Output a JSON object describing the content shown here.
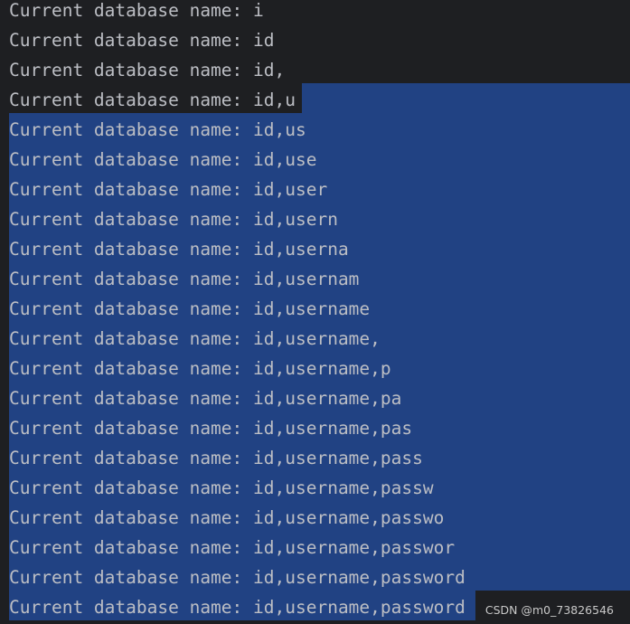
{
  "console": {
    "lines": [
      "Current database name: i",
      "Current database name: id",
      "Current database name: id,",
      "Current database name: id,u",
      "Current database name: id,us",
      "Current database name: id,use",
      "Current database name: id,user",
      "Current database name: id,usern",
      "Current database name: id,userna",
      "Current database name: id,usernam",
      "Current database name: id,username",
      "Current database name: id,username,",
      "Current database name: id,username,p",
      "Current database name: id,username,pa",
      "Current database name: id,username,pas",
      "Current database name: id,username,pass",
      "Current database name: id,username,passw",
      "Current database name: id,username,passwo",
      "Current database name: id,username,passwor",
      "Current database name: id,username,password",
      "Current database name: id,username,password"
    ]
  },
  "watermark": "CSDN @m0_73826546",
  "colors": {
    "background": "#1e1f22",
    "selection": "#214283",
    "text": "#bcbec4"
  }
}
